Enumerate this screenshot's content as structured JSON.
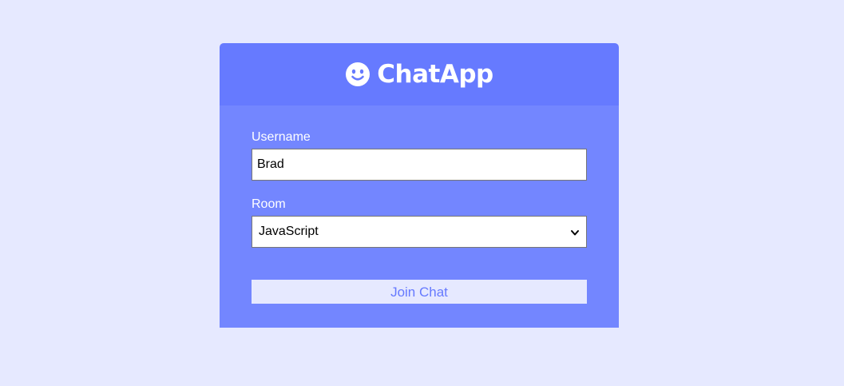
{
  "header": {
    "title": "ChatApp",
    "icon": "smile-icon"
  },
  "form": {
    "username_label": "Username",
    "username_value": "Brad",
    "room_label": "Room",
    "room_selected": "JavaScript",
    "join_label": "Join Chat"
  },
  "colors": {
    "page_background": "#e6e9ff",
    "header_background": "#667aff",
    "form_background": "#7386ff",
    "button_background": "#e6e9ff",
    "button_text": "#667aff"
  }
}
